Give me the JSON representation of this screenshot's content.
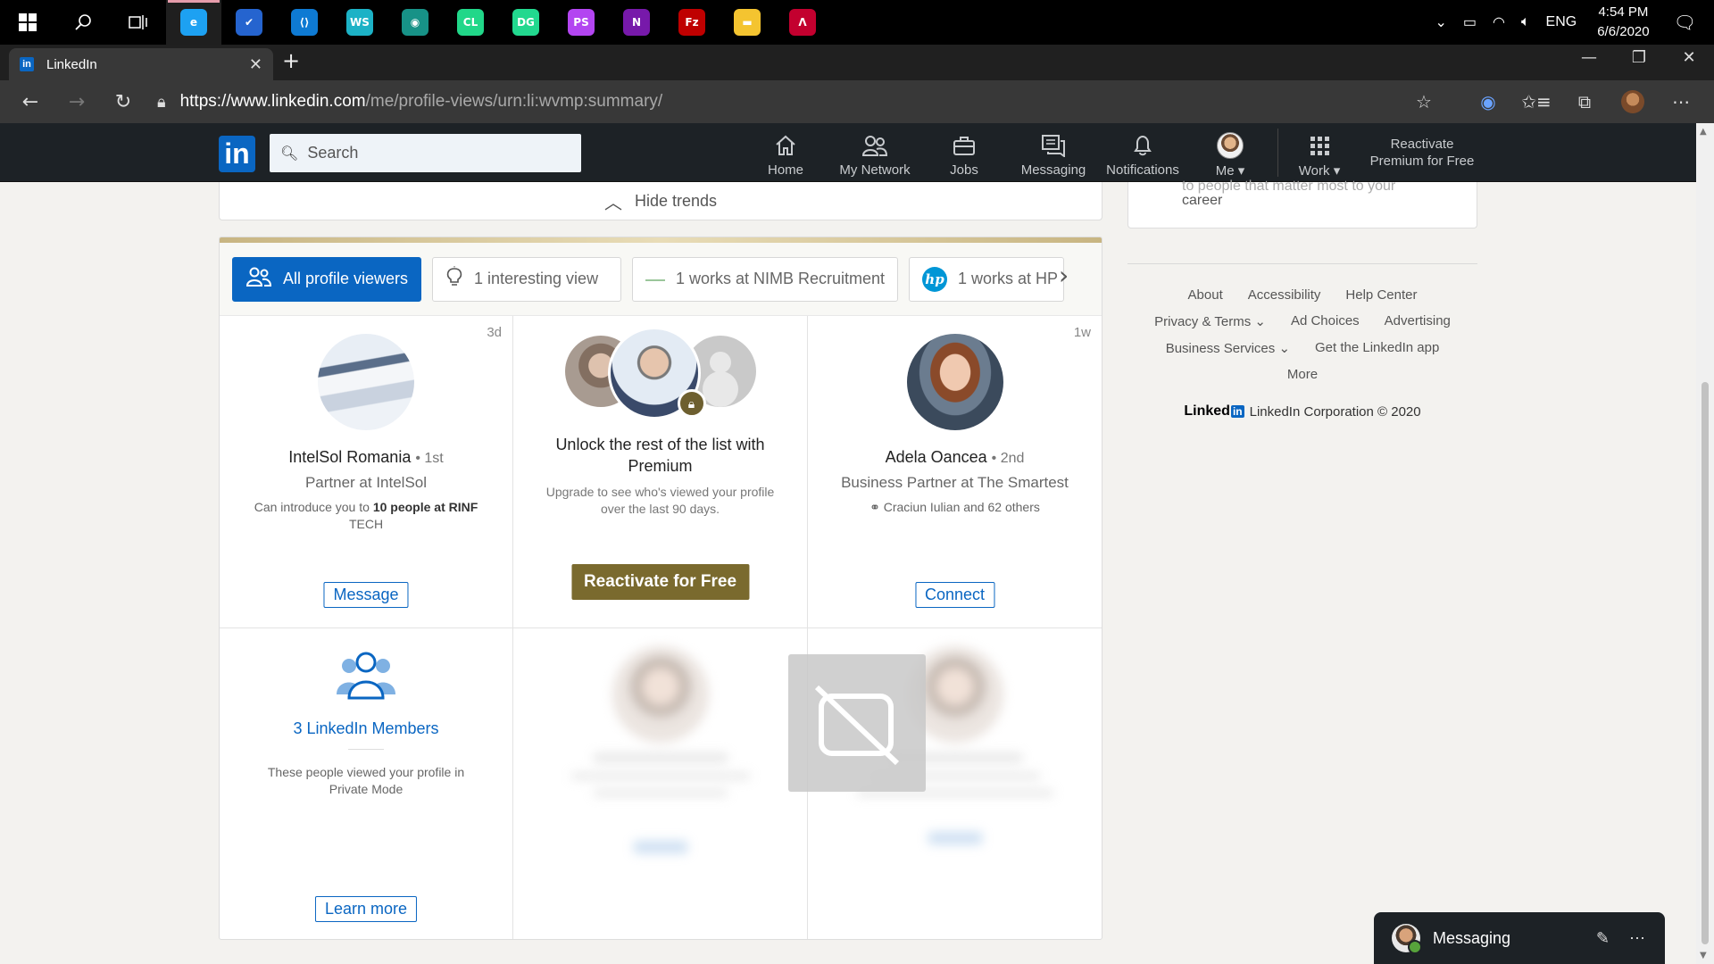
{
  "taskbar": {
    "apps": [
      {
        "name": "edge",
        "label": "e",
        "color": "#1da1f2"
      },
      {
        "name": "todo",
        "label": "✔",
        "color": "#2564cf"
      },
      {
        "name": "vscode",
        "label": "⟨⟩",
        "color": "#0e7ad3"
      },
      {
        "name": "webstorm",
        "label": "WS",
        "color": "#1cb2c6"
      },
      {
        "name": "gitkraken",
        "label": "◉",
        "color": "#179287"
      },
      {
        "name": "clion",
        "label": "CL",
        "color": "#21d789"
      },
      {
        "name": "datagrip",
        "label": "DG",
        "color": "#22d88f"
      },
      {
        "name": "phpstorm",
        "label": "PS",
        "color": "#b345f1"
      },
      {
        "name": "onenote",
        "label": "N",
        "color": "#7719aa"
      },
      {
        "name": "filezilla",
        "label": "Fz",
        "color": "#bf0000"
      },
      {
        "name": "file-explorer",
        "label": "▬",
        "color": "#f4c430"
      },
      {
        "name": "angular-ide",
        "label": "Λ",
        "color": "#c3002f"
      }
    ],
    "tray": {
      "language": "ENG",
      "time": "4:54 PM",
      "date": "6/6/2020"
    }
  },
  "browser": {
    "tab_title": "LinkedIn",
    "tab_favicon": "in",
    "url_host": "https://www.linkedin.com",
    "url_path": "/me/profile-views/urn:li:wvmp:summary/"
  },
  "linkedin_header": {
    "logo": "in",
    "search_placeholder": "Search",
    "nav": [
      {
        "label": "Home",
        "icon": "home-icon"
      },
      {
        "label": "My Network",
        "icon": "network-icon"
      },
      {
        "label": "Jobs",
        "icon": "briefcase-icon"
      },
      {
        "label": "Messaging",
        "icon": "messaging-icon"
      },
      {
        "label": "Notifications",
        "icon": "bell-icon"
      },
      {
        "label": "Me",
        "icon": "avatar"
      },
      {
        "label": "Work",
        "icon": "grid-icon"
      }
    ],
    "premium_cta_line1": "Reactivate",
    "premium_cta_line2": "Premium for Free"
  },
  "trends": {
    "hide_label": "Hide trends"
  },
  "filters": {
    "chips": [
      {
        "label": "All profile viewers",
        "active": true
      },
      {
        "label": "1 interesting view",
        "active": false
      },
      {
        "label": "1 works at NIMB Recruitment",
        "active": false
      },
      {
        "label": "1 works at HP",
        "active": false
      }
    ]
  },
  "viewers": {
    "v1": {
      "ago": "3d",
      "name": "IntelSol Romania",
      "degree": "• 1st",
      "headline": "Partner at IntelSol",
      "intro_prefix": "Can introduce you to ",
      "intro_bold": "10 people at RINF",
      "intro_suffix": " TECH",
      "button": "Message"
    },
    "premium": {
      "title": "Unlock the rest of the list with Premium",
      "subtitle": "Upgrade to see who's viewed your profile over the last 90 days.",
      "button": "Reactivate for Free"
    },
    "v2": {
      "ago": "1w",
      "name": "Adela Oancea",
      "degree": "• 2nd",
      "headline": "Business Partner at The Smartest",
      "shared": "Craciun Iulian and 62 others",
      "button": "Connect"
    },
    "private": {
      "count": "3 LinkedIn Members",
      "note": "These people viewed your profile in Private Mode",
      "button": "Learn more"
    }
  },
  "right_rail": {
    "career_text": "career",
    "cut_text": "to people that matter most to your",
    "footer_links_row1": [
      "About",
      "Accessibility",
      "Help Center"
    ],
    "footer_links_row2": [
      "Privacy & Terms",
      "Ad Choices",
      "Advertising"
    ],
    "footer_links_row3": [
      "Business Services",
      "Get the LinkedIn app"
    ],
    "footer_more": "More",
    "corp_wordmark": "Linked",
    "corp_wordmark_box": "in",
    "corp_text": "LinkedIn Corporation © 2020"
  },
  "messaging_bar": {
    "label": "Messaging"
  }
}
